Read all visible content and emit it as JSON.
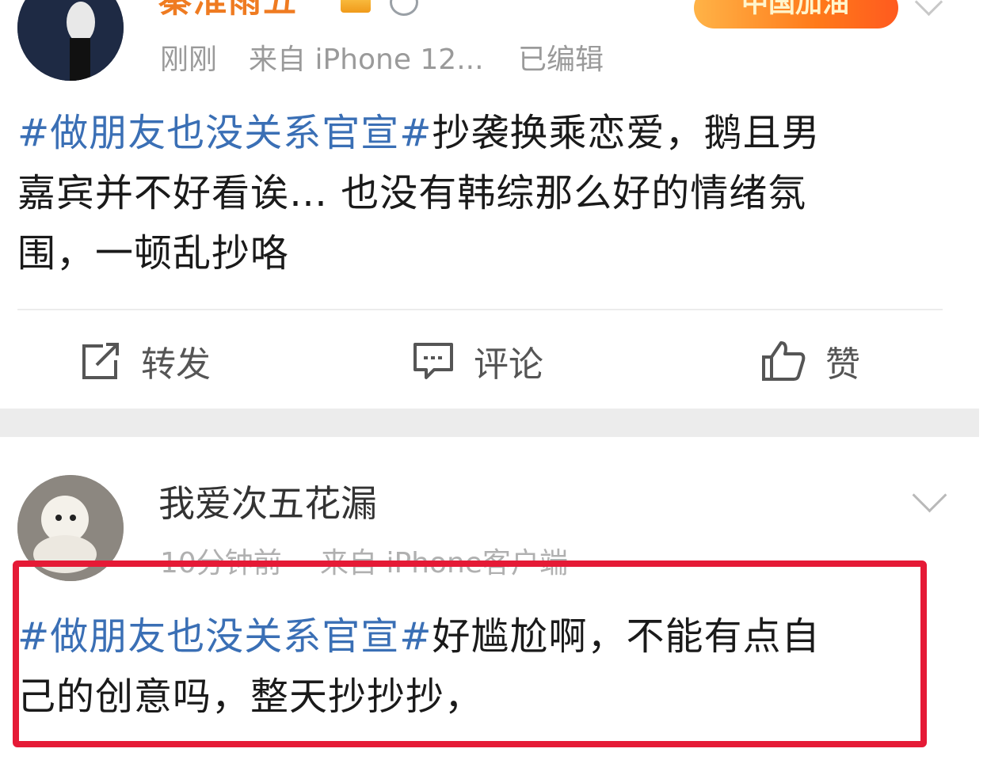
{
  "post1": {
    "username": "秦淮雨五",
    "promo_label": "中国加油",
    "meta": [
      "刚刚",
      "来自 iPhone 12...",
      "已编辑"
    ],
    "hashtag": "#做朋友也没关系官宣#",
    "line1_rest": "抄袭换乘恋爱，鹅且男",
    "line2": "嘉宾并不好看诶… 也没有韩综那么好的情绪氛",
    "line3": "围，一顿乱抄咯",
    "actions": {
      "repost": "转发",
      "comment": "评论",
      "like": "赞"
    }
  },
  "post2": {
    "username": "我爱次五花漏",
    "meta": [
      "10分钟前",
      "来自 iPhone客户端"
    ],
    "hashtag": "#做朋友也没关系官宣#",
    "line1_rest": "好尴尬啊，不能有点自",
    "line2": "己的创意吗，整天抄抄抄，"
  },
  "colors": {
    "hashtag": "#3a6fb5",
    "highlight_box": "#e51a36",
    "username1": "#ef7b21"
  }
}
